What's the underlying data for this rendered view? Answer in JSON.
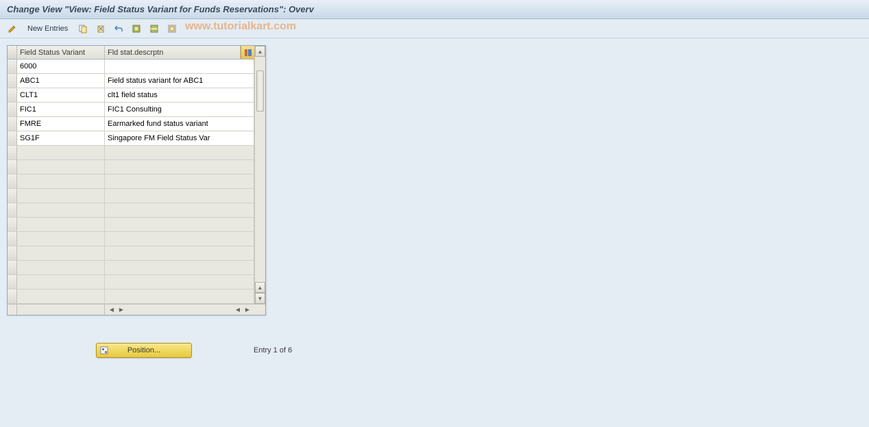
{
  "title": "Change View \"View: Field Status Variant for Funds Reservations\": Overv",
  "toolbar": {
    "new_entries": "New Entries"
  },
  "watermark": "www.tutorialkart.com",
  "table": {
    "headers": {
      "col1": "Field Status Variant",
      "col2": "Fld stat.descrptn"
    },
    "rows": [
      {
        "variant": "6000",
        "desc": ""
      },
      {
        "variant": "ABC1",
        "desc": "Field status variant for ABC1"
      },
      {
        "variant": "CLT1",
        "desc": "clt1 field status"
      },
      {
        "variant": "FIC1",
        "desc": "FIC1 Consulting"
      },
      {
        "variant": "FMRE",
        "desc": "Earmarked fund status variant"
      },
      {
        "variant": "SG1F",
        "desc": "Singapore FM Field Status Var"
      }
    ],
    "empty_rows": 11
  },
  "position_button": "Position...",
  "entry_status": "Entry 1 of 6"
}
